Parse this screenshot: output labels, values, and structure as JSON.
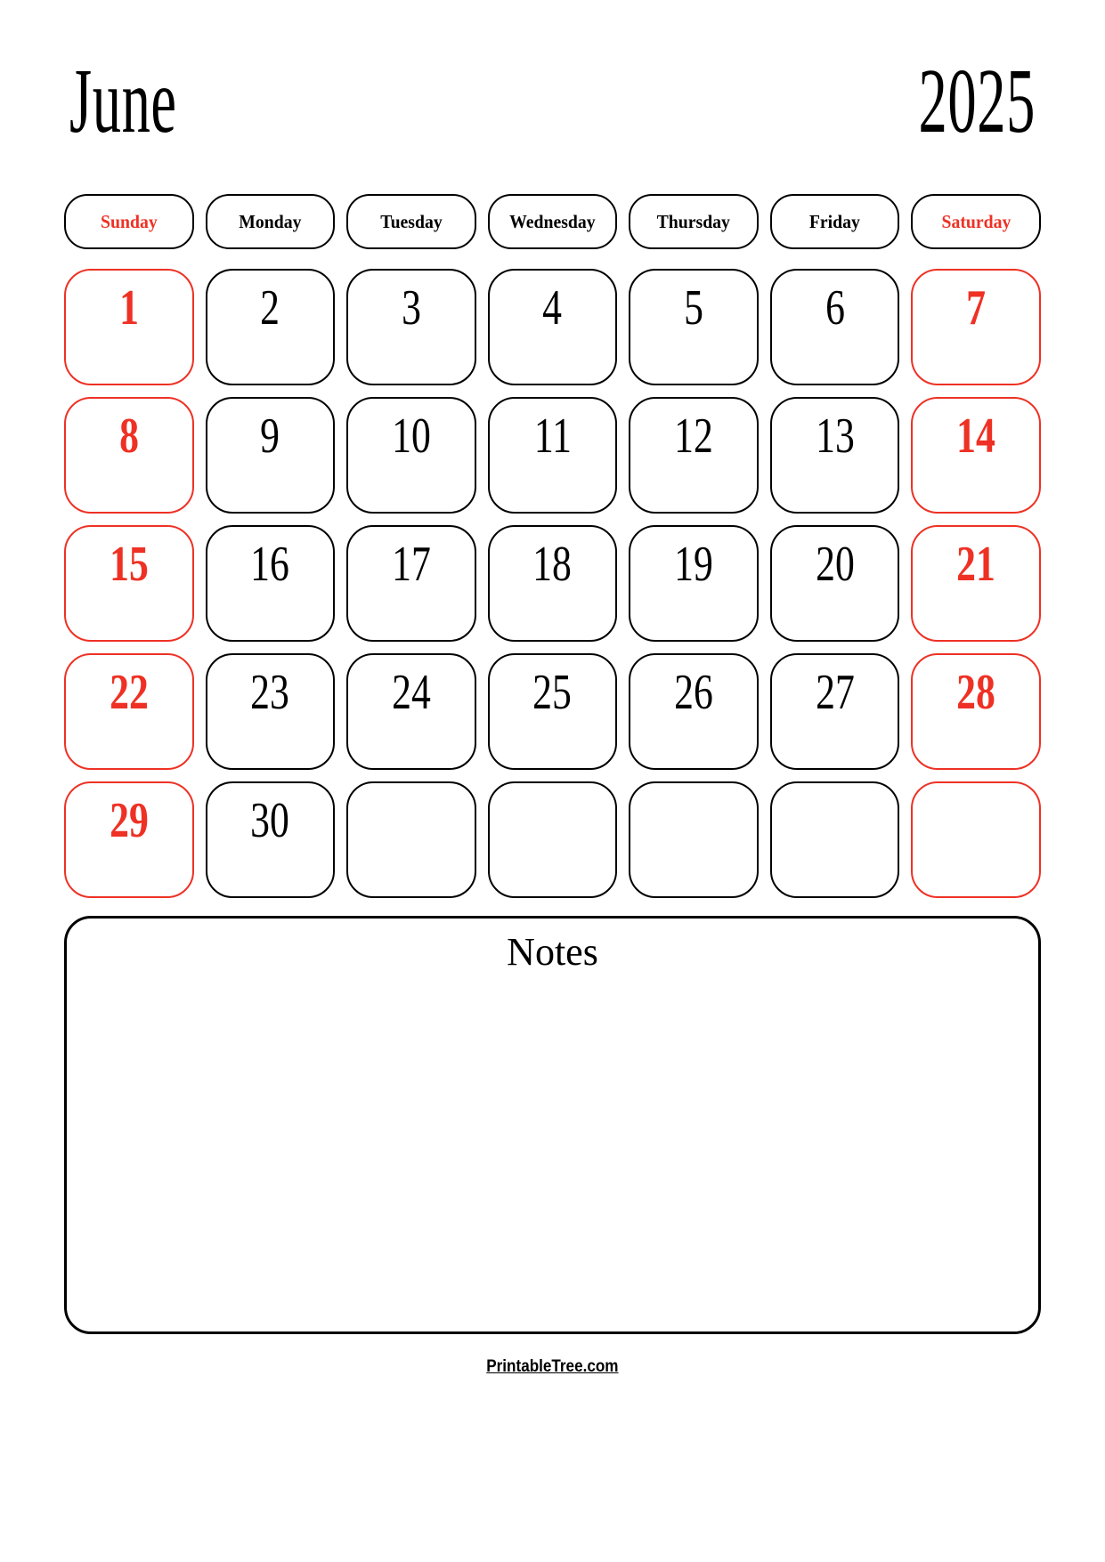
{
  "title": {
    "month": "June",
    "year": "2025"
  },
  "colors": {
    "weekend_red": "#ee3124",
    "text_black": "#000000",
    "background": "#ffffff"
  },
  "weekdays": [
    {
      "label": "Sunday",
      "weekend": true
    },
    {
      "label": "Monday",
      "weekend": false
    },
    {
      "label": "Tuesday",
      "weekend": false
    },
    {
      "label": "Wednesday",
      "weekend": false
    },
    {
      "label": "Thursday",
      "weekend": false
    },
    {
      "label": "Friday",
      "weekend": false
    },
    {
      "label": "Saturday",
      "weekend": true
    }
  ],
  "weeks": [
    [
      {
        "day": "1",
        "weekend": true,
        "empty": false
      },
      {
        "day": "2",
        "weekend": false,
        "empty": false
      },
      {
        "day": "3",
        "weekend": false,
        "empty": false
      },
      {
        "day": "4",
        "weekend": false,
        "empty": false
      },
      {
        "day": "5",
        "weekend": false,
        "empty": false
      },
      {
        "day": "6",
        "weekend": false,
        "empty": false
      },
      {
        "day": "7",
        "weekend": true,
        "empty": false
      }
    ],
    [
      {
        "day": "8",
        "weekend": true,
        "empty": false
      },
      {
        "day": "9",
        "weekend": false,
        "empty": false
      },
      {
        "day": "10",
        "weekend": false,
        "empty": false
      },
      {
        "day": "11",
        "weekend": false,
        "empty": false
      },
      {
        "day": "12",
        "weekend": false,
        "empty": false
      },
      {
        "day": "13",
        "weekend": false,
        "empty": false
      },
      {
        "day": "14",
        "weekend": true,
        "empty": false
      }
    ],
    [
      {
        "day": "15",
        "weekend": true,
        "empty": false
      },
      {
        "day": "16",
        "weekend": false,
        "empty": false
      },
      {
        "day": "17",
        "weekend": false,
        "empty": false
      },
      {
        "day": "18",
        "weekend": false,
        "empty": false
      },
      {
        "day": "19",
        "weekend": false,
        "empty": false
      },
      {
        "day": "20",
        "weekend": false,
        "empty": false
      },
      {
        "day": "21",
        "weekend": true,
        "empty": false
      }
    ],
    [
      {
        "day": "22",
        "weekend": true,
        "empty": false
      },
      {
        "day": "23",
        "weekend": false,
        "empty": false
      },
      {
        "day": "24",
        "weekend": false,
        "empty": false
      },
      {
        "day": "25",
        "weekend": false,
        "empty": false
      },
      {
        "day": "26",
        "weekend": false,
        "empty": false
      },
      {
        "day": "27",
        "weekend": false,
        "empty": false
      },
      {
        "day": "28",
        "weekend": true,
        "empty": false
      }
    ],
    [
      {
        "day": "29",
        "weekend": true,
        "empty": false
      },
      {
        "day": "30",
        "weekend": false,
        "empty": false
      },
      {
        "day": "",
        "weekend": false,
        "empty": true
      },
      {
        "day": "",
        "weekend": false,
        "empty": true
      },
      {
        "day": "",
        "weekend": false,
        "empty": true
      },
      {
        "day": "",
        "weekend": false,
        "empty": true
      },
      {
        "day": "",
        "weekend": true,
        "empty": true
      }
    ]
  ],
  "notes": {
    "title": "Notes",
    "content": ""
  },
  "footer": {
    "link_text": "PrintableTree.com"
  }
}
